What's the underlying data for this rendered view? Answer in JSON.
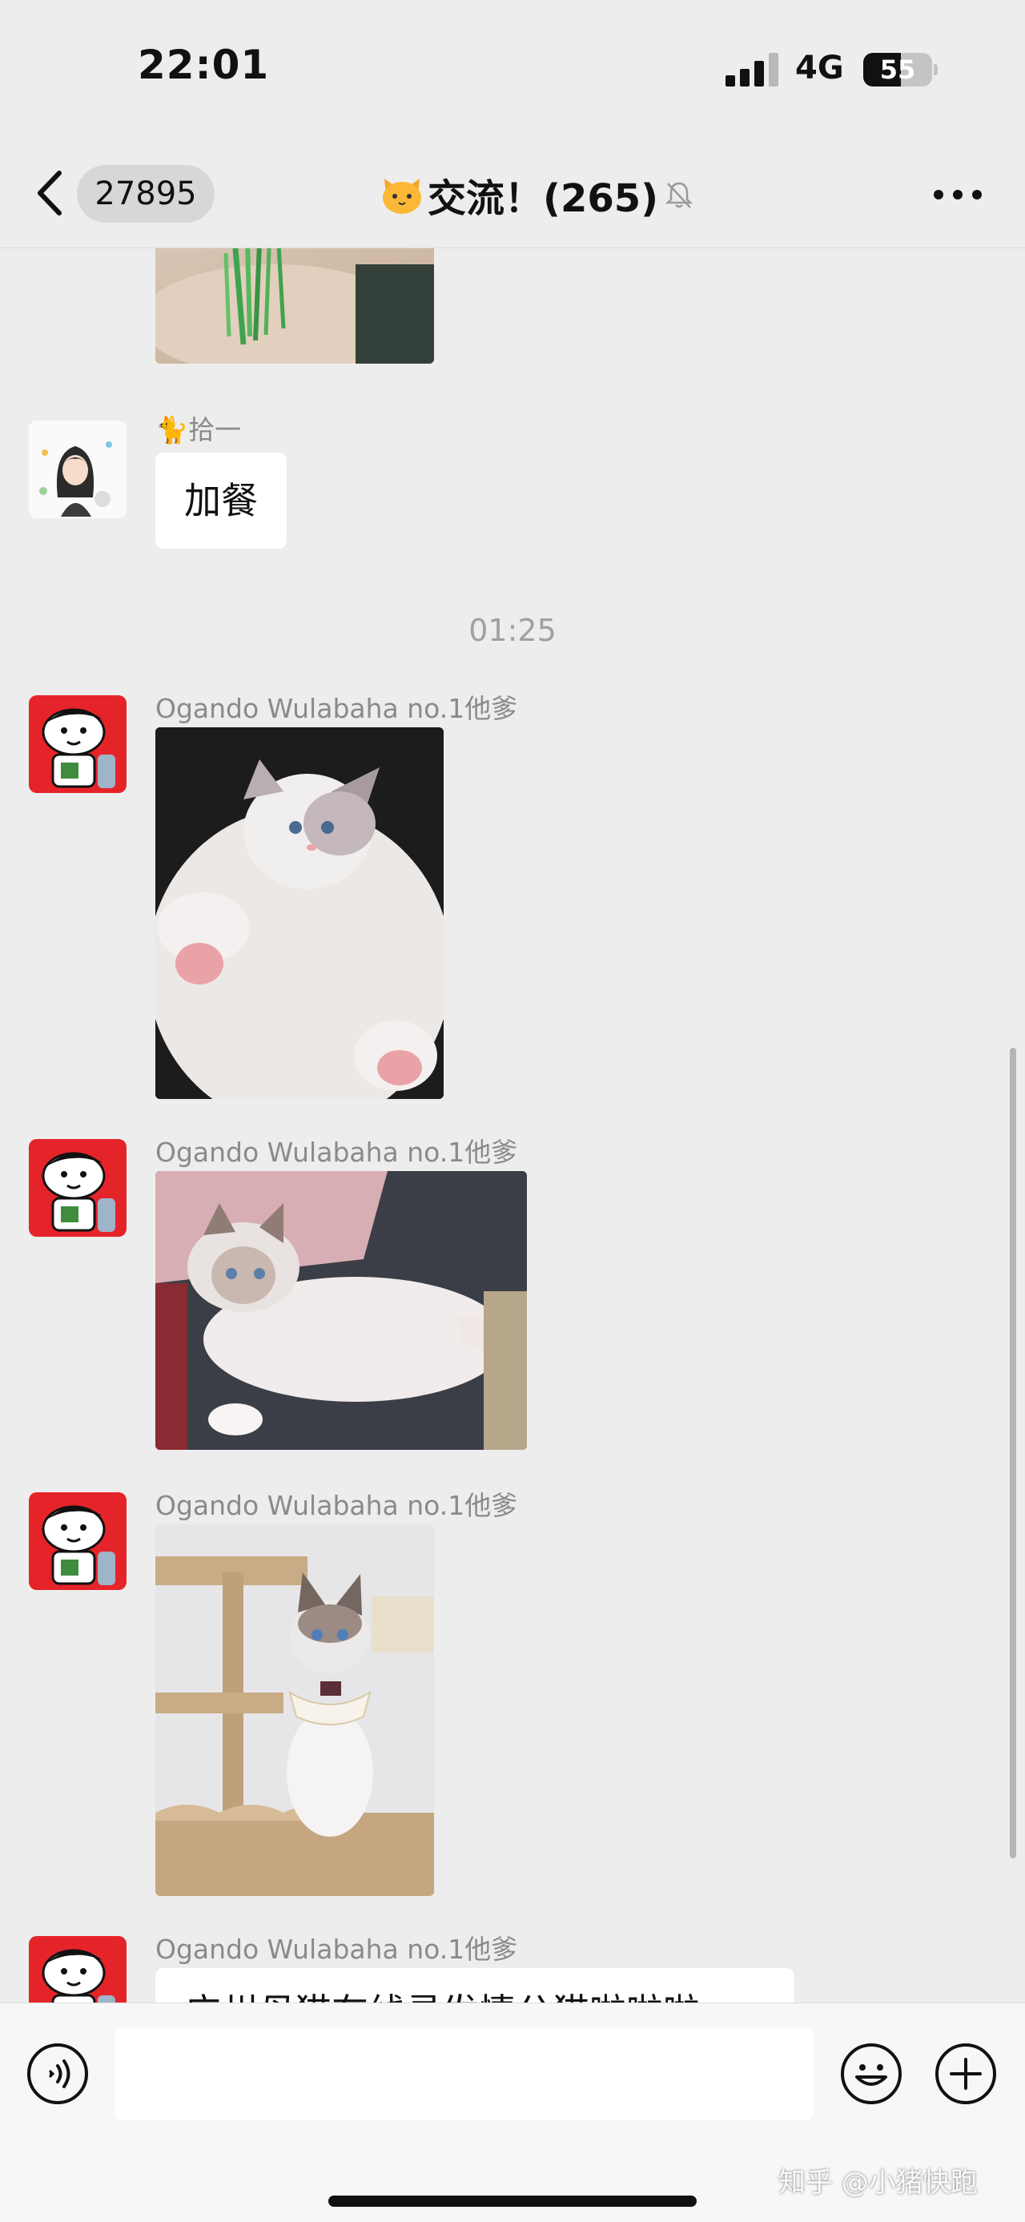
{
  "status_bar": {
    "time": "22:01",
    "network": "4G",
    "battery": "55"
  },
  "nav": {
    "unread_count": "27895",
    "title": "交流！(265)",
    "title_emoji_icon": "cat-face-icon",
    "muted_icon": "bell-slash-icon"
  },
  "messages": {
    "partial_image_top": {
      "type": "image",
      "description_icon": "photo-grass"
    },
    "msg1": {
      "sender": "🐈拾一",
      "text": "加餐"
    },
    "time_divider": "01:25",
    "msg2": {
      "sender": "Ogando Wulabaha no.1他爹"
    },
    "msg3": {
      "sender": "Ogando Wulabaha no.1他爹"
    },
    "msg4": {
      "sender": "Ogando Wulabaha no.1他爹"
    },
    "msg5": {
      "sender": "Ogando Wulabaha no.1他爹",
      "text": "广州母猫在线寻发情公猫啦啦啦"
    }
  },
  "input_bar": {
    "placeholder": ""
  },
  "watermark": "知乎 @小猪快跑",
  "colors": {
    "background": "#ededed",
    "bubble": "#ffffff",
    "sender": "#8a8a8a",
    "avatar_red": "#e5242a"
  }
}
